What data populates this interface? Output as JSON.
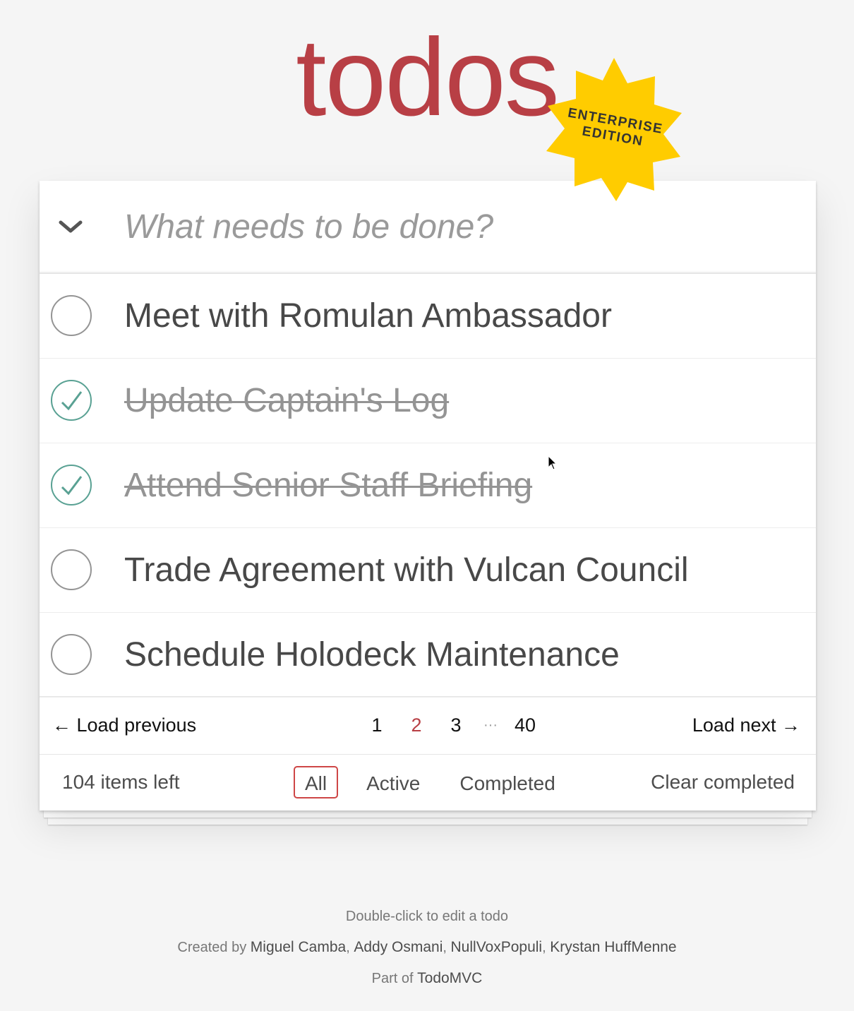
{
  "header": {
    "title": "todos",
    "badge_line1": "ENTERPRISE",
    "badge_line2": "EDITION"
  },
  "input": {
    "placeholder": "What needs to be done?",
    "value": ""
  },
  "todos": [
    {
      "label": "Meet with Romulan Ambassador",
      "completed": false
    },
    {
      "label": "Update Captain's Log",
      "completed": true
    },
    {
      "label": "Attend Senior Staff Briefing",
      "completed": true
    },
    {
      "label": "Trade Agreement with Vulcan Council",
      "completed": false
    },
    {
      "label": "Schedule Holodeck Maintenance",
      "completed": false
    }
  ],
  "pagination": {
    "prev_label": "← Load previous",
    "next_label": "Load next →",
    "pages": [
      "1",
      "2",
      "3"
    ],
    "ellipsis": "···",
    "last_page": "40",
    "current_page": "2"
  },
  "footer": {
    "count_text": "104 items left",
    "filters": [
      "All",
      "Active",
      "Completed"
    ],
    "selected_filter": "All",
    "clear_label": "Clear completed"
  },
  "info": {
    "hint": "Double-click to edit a todo",
    "created_by_prefix": "Created by",
    "authors": [
      "Miguel Camba",
      "Addy Osmani",
      "NullVoxPopuli",
      "Krystan HuffMenne"
    ],
    "part_of_prefix": "Part of",
    "part_of_link": "TodoMVC"
  },
  "colors": {
    "title": "#b83f45",
    "badge": "#ffcc00",
    "check_done": "#59a193",
    "filter_border": "#ce4646"
  }
}
